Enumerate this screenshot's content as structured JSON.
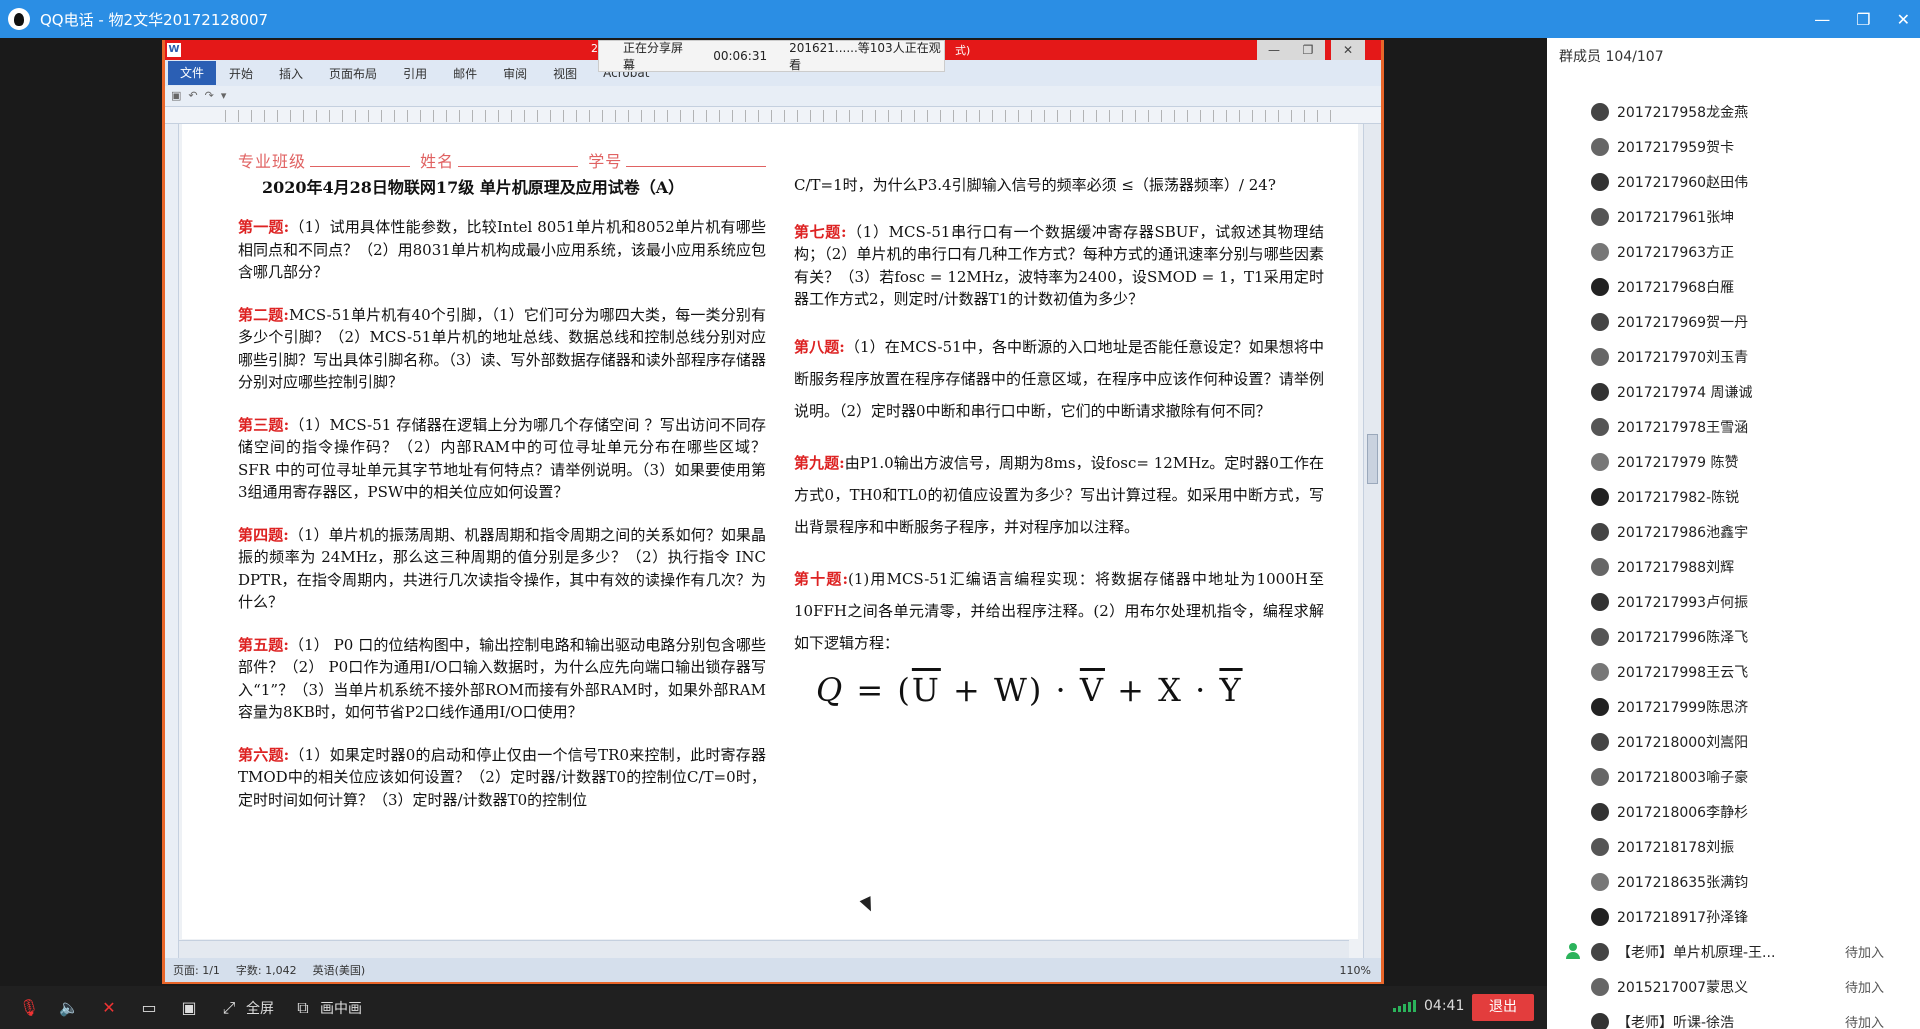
{
  "window": {
    "title": "QQ电话 - 物2文华20172128007",
    "controls": [
      "—",
      "❐",
      "✕"
    ]
  },
  "share_bar": {
    "status": "正在分享屏幕",
    "elapsed": "00:06:31",
    "viewers": "201621......等103人正在观看"
  },
  "word": {
    "title_fragment": "20",
    "title_suffix": "式)",
    "tabs": [
      "文件",
      "开始",
      "插入",
      "页面布局",
      "引用",
      "邮件",
      "审阅",
      "视图",
      "Acrobat"
    ],
    "status": {
      "page": "页面: 1/1",
      "words": "字数: 1,042",
      "lang": "英语(美国)",
      "zoom": "110%"
    }
  },
  "doc": {
    "header": {
      "a": "专业班级",
      "b": "姓名",
      "c": "学号"
    },
    "title": "2020年4月28日物联网17级 单片机原理及应用试卷（A）",
    "right_top": "C/T=1时，为什么P3.4引脚输入信号的频率必须 ≤（振荡器频率）/ 24?",
    "questions_left": [
      {
        "label": "第一题:",
        "text": "（1）试用具体性能参数，比较Intel 8051单片机和8052单片机有哪些相同点和不同点？（2）用8031单片机构成最小应用系统，该最小应用系统应包含哪几部分？"
      },
      {
        "label": "第二题:",
        "text": "MCS-51单片机有40个引脚，（1）它们可分为哪四大类，每一类分别有多少个引脚？（2）MCS-51单片机的地址总线、数据总线和控制总线分别对应哪些引脚？写出具体引脚名称。（3）读、写外部数据存储器和读外部程序存储器分别对应哪些控制引脚？"
      },
      {
        "label": "第三题:",
        "text": "（1）MCS-51 存储器在逻辑上分为哪几个存储空间 ？写出访问不同存储空间的指令操作码？（2）内部RAM中的可位寻址单元分布在哪些区域？SFR 中的可位寻址单元其字节地址有何特点？请举例说明。（3）如果要使用第3组通用寄存器区，PSW中的相关位应如何设置？"
      },
      {
        "label": "第四题:",
        "text": "（1）单片机的振荡周期、机器周期和指令周期之间的关系如何？如果晶振的频率为 24MHz，那么这三种周期的值分别是多少？（2）执行指令 INC DPTR，在指令周期内，共进行几次读指令操作，其中有效的读操作有几次？为什么？"
      },
      {
        "label": "第五题:",
        "text": "（1） P0 口的位结构图中，输出控制电路和输出驱动电路分别包含哪些部件？（2） P0口作为通用I/O口输入数据时，为什么应先向端口输出锁存器写入“1”？（3）当单片机系统不接外部ROM而接有外部RAM时，如果外部RAM容量为8KB时，如何节省P2口线作通用I/O口使用？"
      },
      {
        "label": "第六题:",
        "text": "（1）如果定时器0的启动和停止仅由一个信号TR0来控制，此时寄存器TMOD中的相关位应该如何设置？（2）定时器/计数器T0的控制位C/T=0时，定时时间如何计算？（3）定时器/计数器T0的控制位"
      }
    ],
    "questions_right": [
      {
        "label": "第七题:",
        "text": "（1）MCS-51串行口有一个数据缓冲寄存器SBUF，试叙述其物理结构；（2）单片机的串行口有几种工作方式？每种方式的通讯速率分别与哪些因素有关？（3）若fosc = 12MHz，波特率为2400，设SMOD = 1，T1采用定时器工作方式2，则定时/计数器T1的计数初值为多少？"
      },
      {
        "label": "第八题:",
        "text": "（1）在MCS-51中，各中断源的入口地址是否能任意设定？如果想将中断服务程序放置在程序存储器中的任意区域，在程序中应该作何种设置？请举例说明。（2）定时器0中断和串行口中断，它们的中断请求撤除有何不同？"
      },
      {
        "label": "第九题:",
        "text": "由P1.0输出方波信号，周期为8ms，设fosc= 12MHz。定时器0工作在方式0，TH0和TL0的初值应设置为多少？写出计算过程。如采用中断方式，写出背景程序和中断服务子程序，并对程序加以注释。"
      },
      {
        "label": "第十题:",
        "text": "(1)用MCS-51汇编语言编程实现：将数据存储器中地址为1000H至10FFH之间各单元清零，并给出程序注释。(2）用布尔处理机指令，编程求解如下逻辑方程："
      }
    ],
    "formula": {
      "lhs": "Q",
      "u": "U",
      "w": "W",
      "v": "V",
      "x": "X",
      "y": "Y"
    }
  },
  "members": {
    "header": "群成员 104/107",
    "list": [
      {
        "name": "2017217958龙金燕",
        "status": ""
      },
      {
        "name": "2017217959贺卡",
        "status": ""
      },
      {
        "name": "2017217960赵田伟",
        "status": ""
      },
      {
        "name": "2017217961张坤",
        "status": ""
      },
      {
        "name": "2017217963方正",
        "status": ""
      },
      {
        "name": "2017217968白雁",
        "status": ""
      },
      {
        "name": "2017217969贺一丹",
        "status": ""
      },
      {
        "name": "2017217970刘玉青",
        "status": ""
      },
      {
        "name": "2017217974 周谦诚",
        "status": ""
      },
      {
        "name": "2017217978王雪涵",
        "status": ""
      },
      {
        "name": "2017217979 陈赞",
        "status": ""
      },
      {
        "name": "2017217982-陈锐",
        "status": ""
      },
      {
        "name": "2017217986池鑫宇",
        "status": ""
      },
      {
        "name": "2017217988刘辉",
        "status": ""
      },
      {
        "name": "2017217993卢何振",
        "status": ""
      },
      {
        "name": "2017217996陈泽飞",
        "status": ""
      },
      {
        "name": "2017217998王云飞",
        "status": ""
      },
      {
        "name": "2017217999陈思济",
        "status": ""
      },
      {
        "name": "2017218000刘嵩阳",
        "status": ""
      },
      {
        "name": "2017218003喻子豪",
        "status": ""
      },
      {
        "name": "2017218006李静杉",
        "status": ""
      },
      {
        "name": "2017218178刘振",
        "status": ""
      },
      {
        "name": "2017218635张满钧",
        "status": ""
      },
      {
        "name": "2017218917孙泽锋",
        "status": ""
      },
      {
        "name": "【老师】单片机原理-王...",
        "status": "待加入"
      },
      {
        "name": "2015217007蒙思义",
        "status": "待加入"
      },
      {
        "name": "【老师】听课-徐浩",
        "status": "待加入"
      }
    ]
  },
  "bottombar": {
    "fullscreen": "全屏",
    "pip": "画中画",
    "timer": "04:41",
    "exit": "退出"
  }
}
